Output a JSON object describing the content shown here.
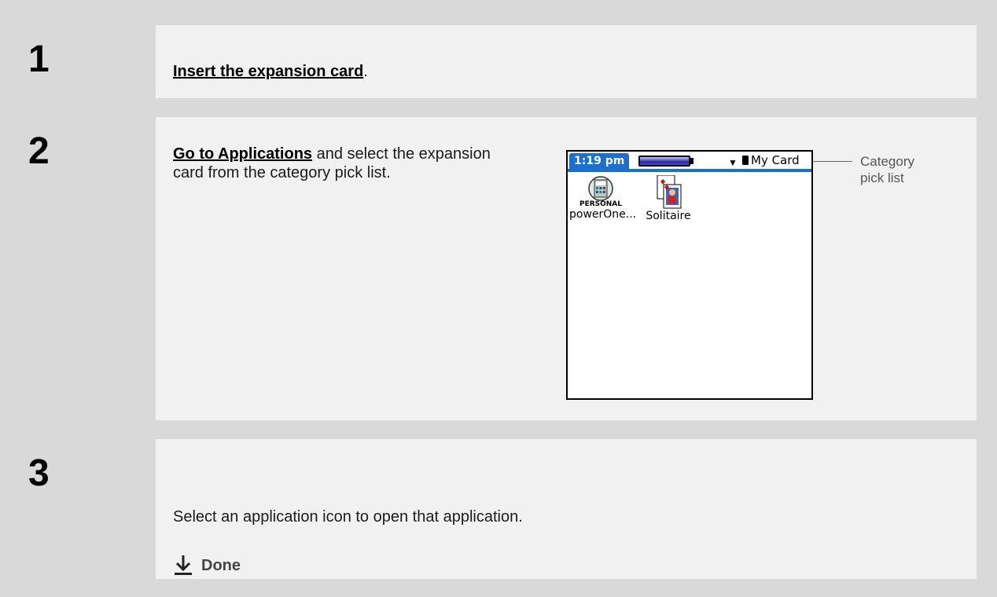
{
  "steps": [
    {
      "number": "1",
      "link": "Insert the expansion card",
      "text": "."
    },
    {
      "number": "2",
      "link": "Go to Applications",
      "text": " and select the expansion card from the category pick list."
    },
    {
      "number": "3",
      "text": "Select an application icon to open that application.",
      "done": "Done"
    }
  ],
  "device": {
    "time": "1:19 pm",
    "category": "My Card",
    "apps": [
      {
        "label": "powerOne...",
        "sub_label": "PERSONAL"
      },
      {
        "label": "Solitaire"
      }
    ]
  },
  "callout": {
    "line1": "Category",
    "line2": "pick list"
  },
  "colors": {
    "accent": "#1a6fd0",
    "background": "#d9d9d9",
    "panel": "#f1f1f1"
  }
}
